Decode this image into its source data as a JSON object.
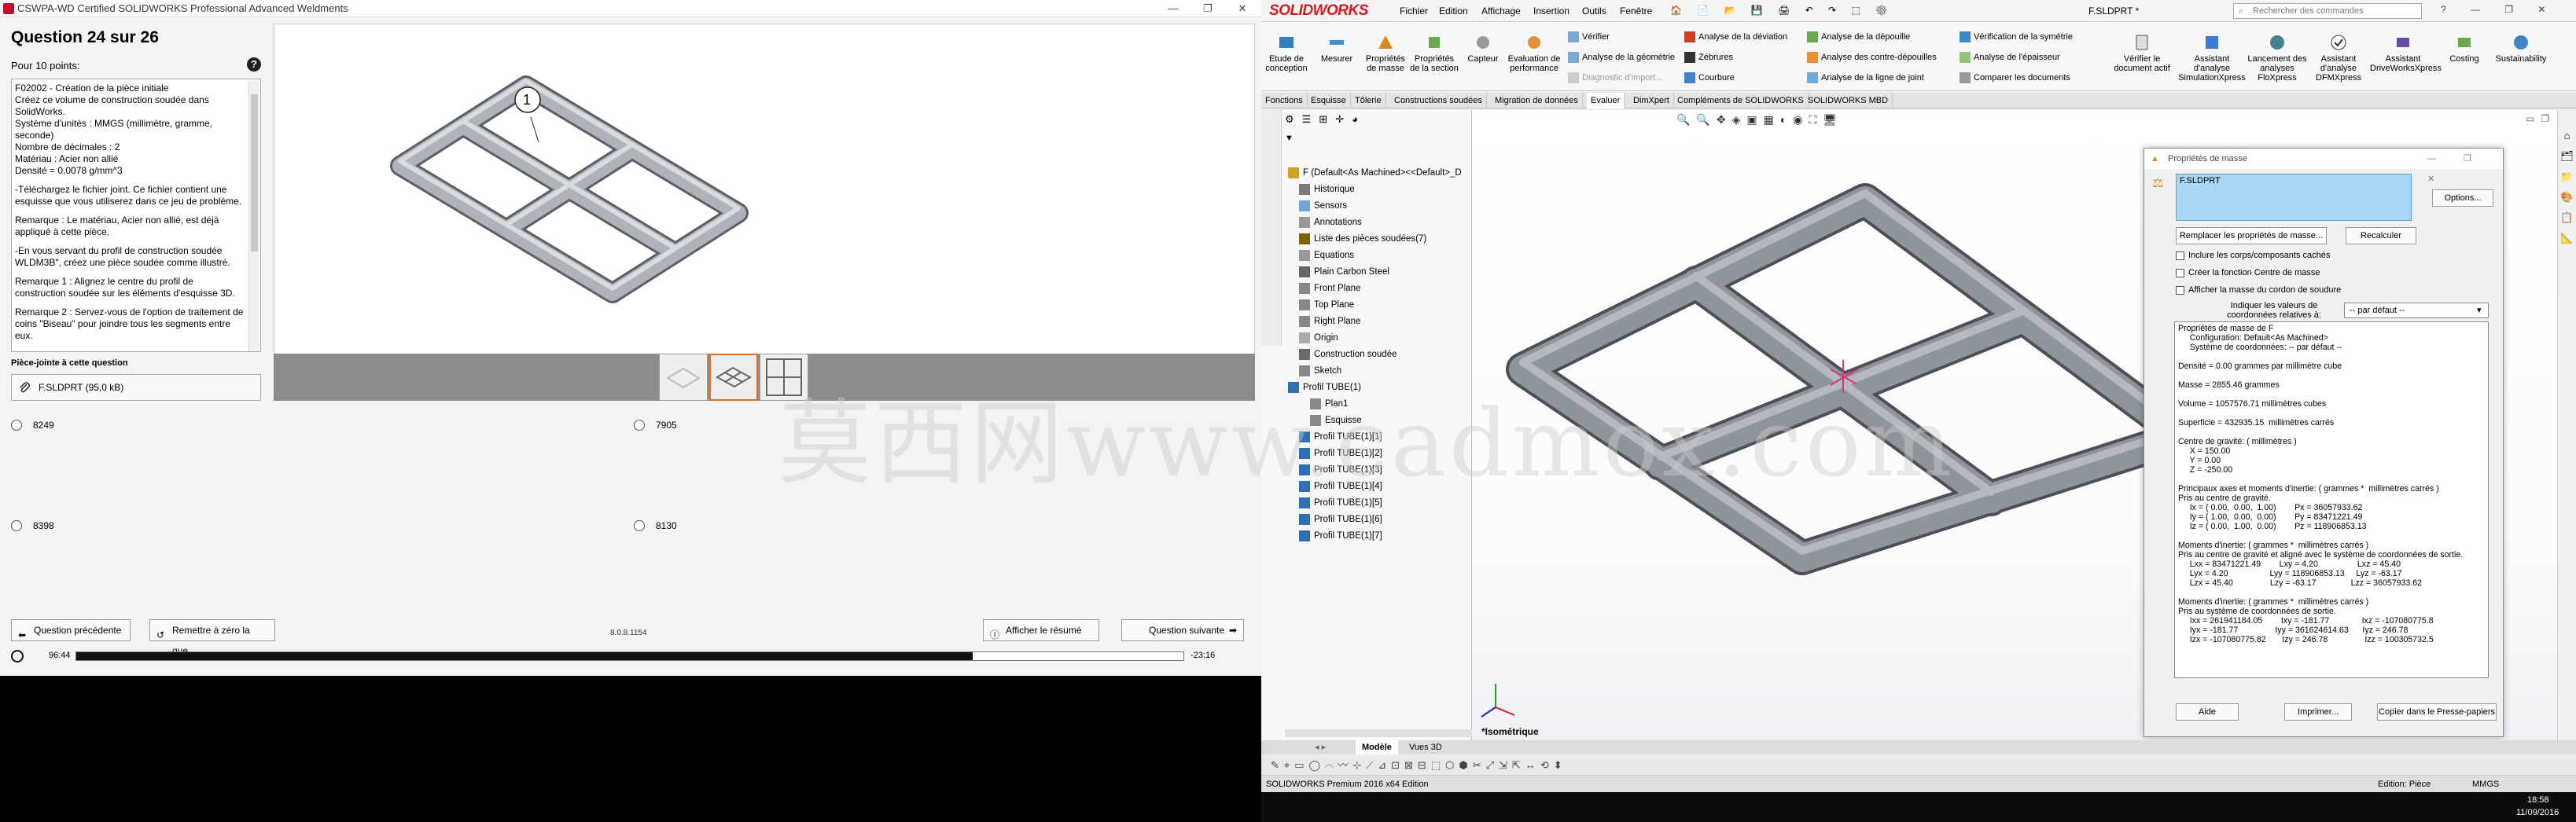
{
  "exam": {
    "window_title": "CSWPA-WD Certified SOLIDWORKS Professional Advanced Weldments",
    "question_title": "Question 24 sur 26",
    "points": "Pour 10 points:",
    "help_symbol": "?",
    "question_paragraphs": [
      "F02002 - Création de la pièce initiale\nCréez ce volume de construction soudée dans SolidWorks.\nSystème d'unités : MMGS (millimètre, gramme, seconde)\nNombre de décimales : 2\nMatériau : Acier non allié\nDensité = 0,0078 g/mm^3",
      "-Téléchargez le fichier joint.  Ce fichier contient une esquisse que vous utiliserez dans ce jeu de problème.",
      "Remarque : Le matériau, Acier non allié, est déjà appliqué à cette pièce.",
      "-En vous servant du profil de construction soudée WLDM3B\", créez une pièce soudée comme illustré.",
      "Remarque 1 : Alignez le centre du profil de construction soudée sur les éléments d'esquisse 3D.",
      "Remarque 2 : Servez-vous de l'option de traitement de coins \"Biseau\" pour joindre tous les segments entre eux."
    ],
    "attachment_label": "Pièce-jointe à cette question",
    "attachment_file": "F.SLDPRT (95,0 kB)",
    "callout_number": "1",
    "answers": [
      "8249",
      "7905",
      "8398",
      "8130"
    ],
    "prev_label": "Question précédente",
    "reset_label": "Remettre à zéro la que...",
    "summary_label": "Afficher le résumé",
    "next_label": "Question suivante",
    "version": "8.0.8.1154",
    "time_elapsed": "96:44",
    "time_remaining": "-23:16",
    "progress_fraction": 0.81
  },
  "sw": {
    "logo": "SOLIDWORKS",
    "menu": [
      "Fichier",
      "Edition",
      "Affichage",
      "Insertion",
      "Outils",
      "Fenêtre"
    ],
    "doc_title": "F.SLDPRT *",
    "search_placeholder": "Rechercher des commandes",
    "ribbon_big": [
      "Etude de conception",
      "Mesurer",
      "Propriétés de masse",
      "Propriétés de la section",
      "Capteur",
      "Evaluation de performance",
      "Vérifier le document actif",
      "Assistant d'analyse SimulationXpress",
      "Lancement des analyses FloXpress",
      "Assistant d'analyse DFMXpress",
      "Assistant DriveWorksXpress",
      "Costing",
      "Sustainability"
    ],
    "ribbon_small": [
      "Vérifier",
      "Analyse de la géométrie",
      "Diagnostic d'import...",
      "Analyse de la déviation",
      "Zébrures",
      "Courbure",
      "Analyse de la dépouille",
      "Analyse des contre-dépouilles",
      "Analyse de la ligne de joint",
      "Vérification de la symétrie",
      "Analyse de l'épaisseur",
      "Comparer les documents"
    ],
    "tabs": [
      "Fonctions",
      "Esquisse",
      "Tôlerie",
      "Constructions soudées",
      "Migration de données",
      "Evaluer",
      "DimXpert",
      "Compléments de SOLIDWORKS",
      "SOLIDWORKS MBD"
    ],
    "active_tab": "Evaluer",
    "tree": [
      "F  (Default<As Machined><<Default>_D",
      "Historique",
      "Sensors",
      "Annotations",
      "Liste des pièces soudées(7)",
      "Equations",
      "Plain Carbon Steel",
      "Front Plane",
      "Top Plane",
      "Right Plane",
      "Origin",
      "Construction soudée",
      "Sketch",
      "Profil TUBE(1)",
      "Plan1",
      "Esquisse",
      "Profil TUBE(1)[1]",
      "Profil TUBE(1)[2]",
      "Profil TUBE(1)[3]",
      "Profil TUBE(1)[4]",
      "Profil TUBE(1)[5]",
      "Profil TUBE(1)[6]",
      "Profil TUBE(1)[7]"
    ],
    "view_label": "*Isométrique",
    "bottom_tabs": [
      "Modèle",
      "Vues 3D"
    ],
    "status_edit": "Edition: Pièce",
    "status_units": "MMGS",
    "status_product": "SOLIDWORKS Premium 2016 x64 Edition",
    "clock_time": "18:58",
    "clock_date": "11/09/2016"
  },
  "mass_props": {
    "title": "Propriétés de masse",
    "file": "F.SLDPRT",
    "options_label": "Options...",
    "override_label": "Remplacer les propriétés de masse...",
    "recalc_label": "Recalculer",
    "chk_hidden": "Inclure les corps/composants cachés",
    "chk_center": "Créer la fonction Centre de masse",
    "chk_weld": "Afficher la masse du cordon de soudure",
    "report_label": "Indiquer les valeurs de coordonnées relatives à:",
    "report_value": "-- par défaut --",
    "results": [
      "Propriétés de masse de F",
      "     Configuration: Default<As Machined>",
      "     Système de coordonnées: -- par défaut --",
      "",
      "Densité = 0.00 grammes par millimètre cube",
      "",
      "Masse = 2855.46 grammes",
      "",
      "Volume = 1057576.71 millimètres cubes",
      "",
      "Superficie = 432935.15  millimètres carrés",
      "",
      "Centre de gravité: ( millimètres )",
      "     X = 150.00",
      "     Y = 0.00",
      "     Z = -250.00",
      "",
      "Principaux axes et moments d'inertie: ( grammes *  millimètres carrés )",
      "Pris au centre de gravité.",
      "     Ix = ( 0.00,  0.00,  1.00)        Px = 36057933.62",
      "     Iy = ( 1.00,  0.00,  0.00)        Py = 83471221.49",
      "     Iz = ( 0.00,  1.00,  0.00)        Pz = 118906853.13",
      "",
      "Moments d'inertie: ( grammes *  millimètres carrés )",
      "Pris au centre de gravité et aligné avec le système de coordonnées de sortie.",
      "     Lxx = 83471221.49        Lxy = 4.20                 Lxz = 45.40",
      "     Lyx = 4.20                  Lyy = 118906853.13     Lyz = -63.17",
      "     Lzx = 45.40                Lzy = -63.17               Lzz = 36057933.62",
      "",
      "Moments d'inertie: ( grammes *  millimètres carrés )",
      "Pris au système de coordonnées de sortie.",
      "     Ixx = 261941184.05        Ixy = -181.77              Ixz = -107080775.8",
      "     Iyx = -181.77                Iyy = 361624614.63      Iyz = 246.78",
      "     Izx = -107080775.82       Izy = 246.78                Izz = 100305732.5"
    ],
    "help_label": "Aide",
    "print_label": "Imprimer...",
    "copy_label": "Copier dans le Presse-papiers"
  },
  "watermark": "莫西网www.cadmox.com",
  "colors": {
    "accent_red": "#d71920",
    "tube_gray": "#8f959d",
    "selection_blue": "#a9d6f5"
  }
}
